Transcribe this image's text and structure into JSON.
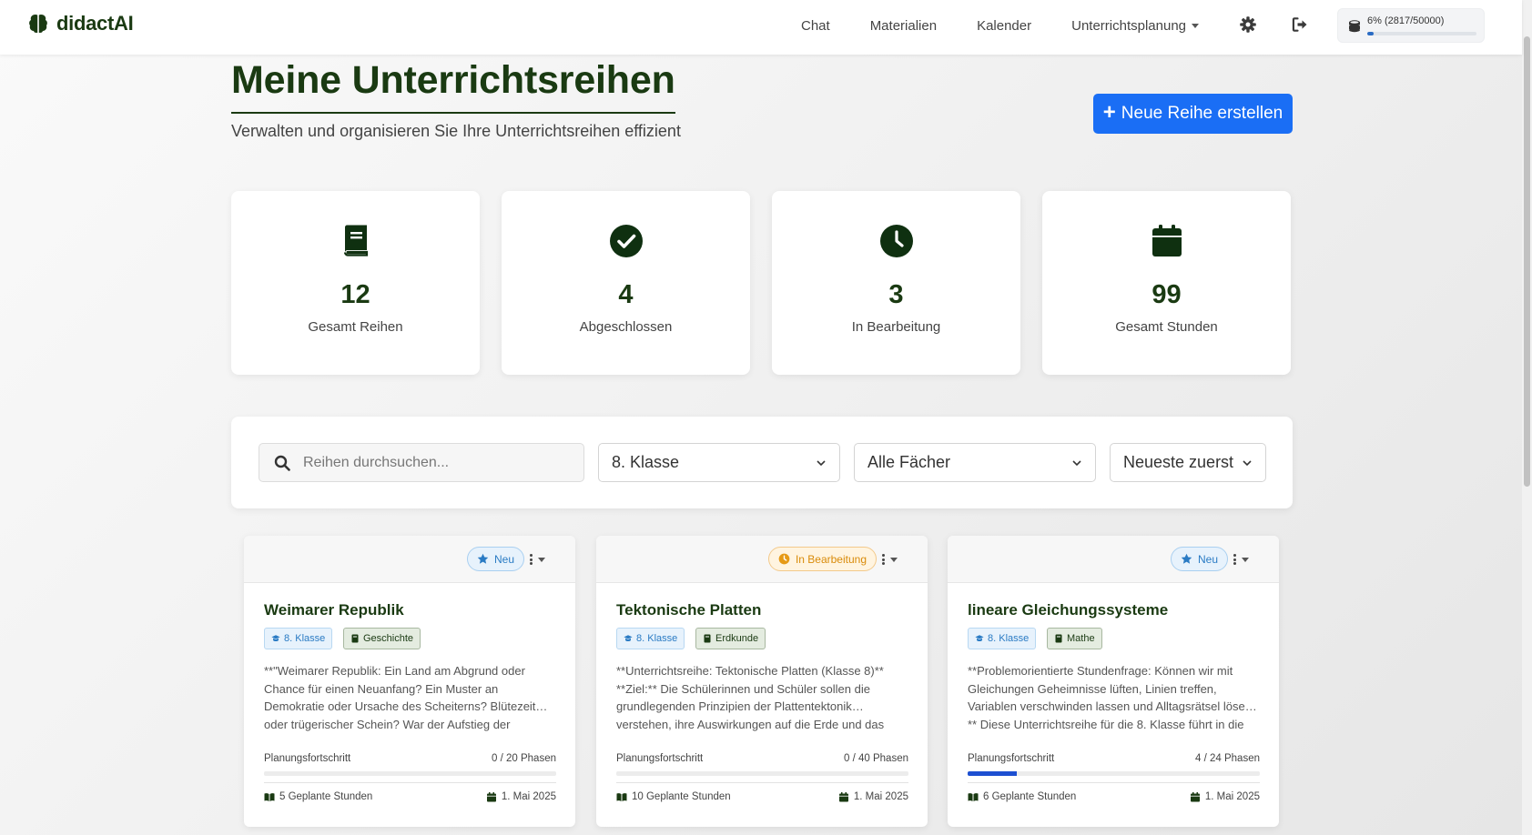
{
  "brand": {
    "name": "didactAI"
  },
  "nav": {
    "links": [
      "Chat",
      "Materialien",
      "Kalender"
    ],
    "planning_label": "Unterrichtsplanung",
    "token_usage_text": "6% (2817/50000)",
    "token_usage_percent": 6
  },
  "header": {
    "title": "Meine Unterrichtsreihen",
    "subtitle": "Verwalten und organisieren Sie Ihre Unterrichtsreihen effizient",
    "new_button_label": "Neue Reihe erstellen"
  },
  "stats": [
    {
      "icon": "book-icon",
      "value": "12",
      "label": "Gesamt Reihen"
    },
    {
      "icon": "check-circle-icon",
      "value": "4",
      "label": "Abgeschlossen"
    },
    {
      "icon": "clock-icon",
      "value": "3",
      "label": "In Bearbeitung"
    },
    {
      "icon": "calendar-icon",
      "value": "99",
      "label": "Gesamt Stunden"
    }
  ],
  "filters": {
    "search_placeholder": "Reihen durchsuchen...",
    "class_select": "8. Klasse",
    "subject_select": "Alle Fächer",
    "sort_select": "Neueste zuerst"
  },
  "colors": {
    "brand_green": "#1a3a12",
    "primary_blue": "#1a6ef5",
    "badge_new": "#2a7bc4",
    "badge_progress": "#d98b0a",
    "progress_fill": "#1d4fd1"
  },
  "cards": [
    {
      "status": "Neu",
      "status_type": "new",
      "title": "Weimarer Republik",
      "class_tag": "8. Klasse",
      "subject_tag": "Geschichte",
      "description": "**\"Weimarer Republik: Ein Land am Abgrund oder Chance für einen Neuanfang? Ein Muster an Demokratie oder Ursache des Scheiterns? Blütezeit… oder trügerischer Schein? War der Aufstieg der",
      "progress_label": "Planungsfortschritt",
      "progress_text": "0 / 20 Phasen",
      "progress_fraction": 0,
      "hours": "5 Geplante Stunden",
      "date": "1. Mai 2025"
    },
    {
      "status": "In Bearbeitung",
      "status_type": "progress",
      "title": "Tektonische Platten",
      "class_tag": "8. Klasse",
      "subject_tag": "Erdkunde",
      "description": "**Unterrichtsreihe: Tektonische Platten (Klasse 8)** **Ziel:** Die Schülerinnen und Schüler sollen die grundlegenden Prinzipien der Plattentektonik… verstehen, ihre Auswirkungen auf die Erde und das",
      "progress_label": "Planungsfortschritt",
      "progress_text": "0 / 40 Phasen",
      "progress_fraction": 0,
      "hours": "10 Geplante Stunden",
      "date": "1. Mai 2025"
    },
    {
      "status": "Neu",
      "status_type": "new",
      "title": "lineare Gleichungssysteme",
      "class_tag": "8. Klasse",
      "subject_tag": "Mathe",
      "description": "**Problemorientierte Stundenfrage: Können wir mit Gleichungen Geheimnisse lüften, Linien treffen, Variablen verschwinden lassen und Alltagsrätsel löse… ** Diese Unterrichtsreihe für die 8. Klasse führt in die",
      "progress_label": "Planungsfortschritt",
      "progress_text": "4 / 24 Phasen",
      "progress_fraction": 0.1667,
      "hours": "6 Geplante Stunden",
      "date": "1. Mai 2025"
    }
  ]
}
